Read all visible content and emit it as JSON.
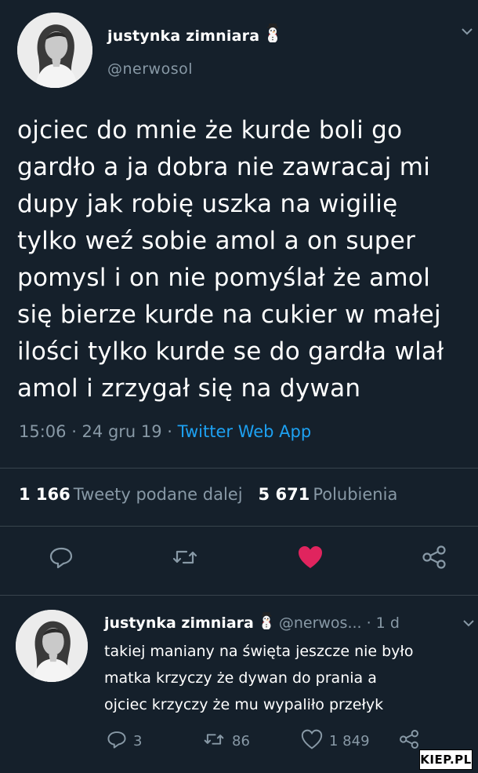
{
  "tweet": {
    "author_name": "justynka zimniara",
    "author_handle": "@nerwosol",
    "text_lines": [
      "ojciec do mnie że kurde boli go",
      "gardło a ja dobra nie zawracaj mi",
      "dupy jak robię uszka na wigilię",
      "tylko weź sobie amol a on super",
      "pomysl i on nie pomyślał że amol",
      "się bierze kurde na cukier w małej",
      "ilości tylko kurde se do gardła wlał",
      "amol i zrzygał się na dywan"
    ],
    "timestamp": "15:06 · 24 gru 19 · ",
    "source": "Twitter Web App",
    "retweets_count": "1 166",
    "retweets_label": "Tweety podane dalej",
    "likes_count": "5 671",
    "likes_label": "Polubienia"
  },
  "reply": {
    "author_name": "justynka zimniara",
    "author_handle_time": "@nerwos... · 1 d",
    "text_lines": [
      "takiej maniany na święta jeszcze nie było",
      "matka krzyczy że dywan do prania a",
      "ojciec krzyczy że mu wypaliło przełyk"
    ],
    "reply_count": "3",
    "retweet_count": "86",
    "like_count": "1 849"
  },
  "watermark": "KIEP.PL",
  "icons": {
    "snowman": "snowman-emoji",
    "reply": "reply-icon",
    "retweet": "retweet-icon",
    "like": "heart-icon",
    "share": "share-icon",
    "caret": "chevron-down-icon"
  },
  "colors": {
    "background": "#15202b",
    "secondary_text": "#8899a6",
    "link": "#1da1f2",
    "like_active": "#e0245e",
    "divider": "#38444d"
  }
}
